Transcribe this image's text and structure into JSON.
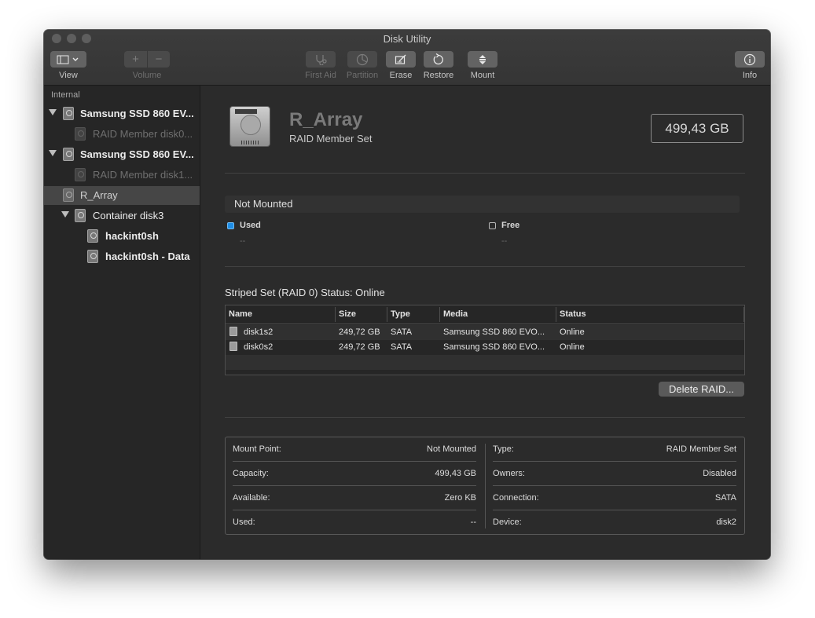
{
  "window": {
    "title": "Disk Utility"
  },
  "toolbar": {
    "view_label": "View",
    "volume_label": "Volume",
    "volume_add": "+",
    "volume_remove": "−",
    "first_aid_label": "First Aid",
    "partition_label": "Partition",
    "erase_label": "Erase",
    "restore_label": "Restore",
    "mount_label": "Mount",
    "info_label": "Info"
  },
  "sidebar": {
    "section_header": "Internal",
    "items": [
      {
        "label": "Samsung SSD 860 EV..."
      },
      {
        "label": "RAID Member disk0..."
      },
      {
        "label": "Samsung SSD 860 EV..."
      },
      {
        "label": "RAID Member disk1..."
      },
      {
        "label": "R_Array"
      },
      {
        "label": "Container disk3"
      },
      {
        "label": "hackint0sh"
      },
      {
        "label": "hackint0sh - Data"
      }
    ]
  },
  "volume": {
    "name": "R_Array",
    "subtitle": "RAID Member Set",
    "capacity": "499,43 GB"
  },
  "usage": {
    "mount_state": "Not Mounted",
    "used_label": "Used",
    "used_value": "--",
    "free_label": "Free",
    "free_value": "--",
    "used_color": "#1f8ee6"
  },
  "raid": {
    "status": "Striped Set (RAID 0) Status: Online",
    "columns": [
      "Name",
      "Size",
      "Type",
      "Media",
      "Status"
    ],
    "rows": [
      {
        "name": "disk1s2",
        "size": "249,72 GB",
        "type": "SATA",
        "media": "Samsung SSD 860 EVO...",
        "status": "Online"
      },
      {
        "name": "disk0s2",
        "size": "249,72 GB",
        "type": "SATA",
        "media": "Samsung SSD 860 EVO...",
        "status": "Online"
      }
    ],
    "delete_label": "Delete RAID..."
  },
  "info": {
    "left": [
      {
        "key": "Mount Point:",
        "value": "Not Mounted"
      },
      {
        "key": "Capacity:",
        "value": "499,43 GB"
      },
      {
        "key": "Available:",
        "value": "Zero KB"
      },
      {
        "key": "Used:",
        "value": "--"
      }
    ],
    "right": [
      {
        "key": "Type:",
        "value": "RAID Member Set"
      },
      {
        "key": "Owners:",
        "value": "Disabled"
      },
      {
        "key": "Connection:",
        "value": "SATA"
      },
      {
        "key": "Device:",
        "value": "disk2"
      }
    ]
  }
}
